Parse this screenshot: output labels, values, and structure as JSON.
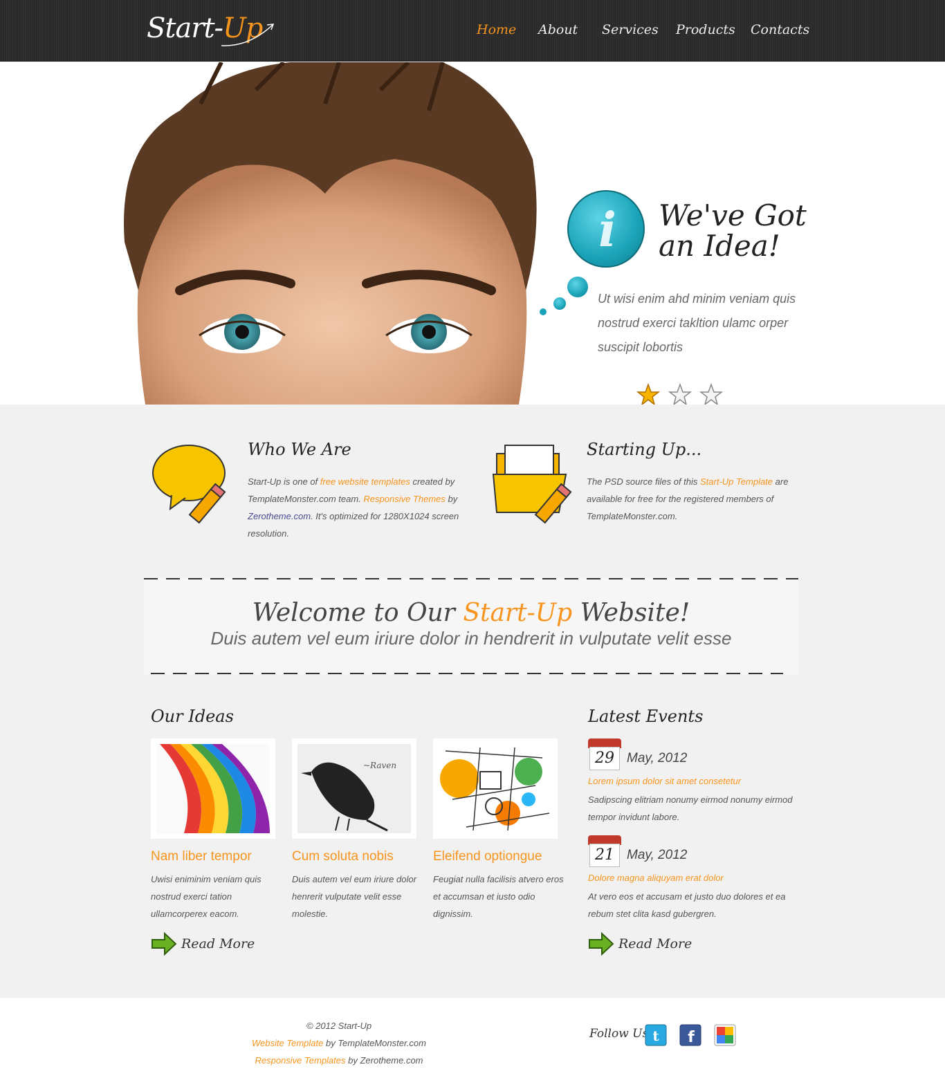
{
  "header": {
    "logo_main": "Start-",
    "logo_accent": "Up",
    "nav": [
      {
        "label": "Home",
        "active": true
      },
      {
        "label": "About",
        "active": false
      },
      {
        "label": "Services",
        "active": false
      },
      {
        "label": "Products",
        "active": false
      },
      {
        "label": "Contacts",
        "active": false
      }
    ]
  },
  "hero": {
    "icon": "info-bubble-icon",
    "title_line1": "We've Got",
    "title_line2": "an Idea!",
    "text": "Ut wisi enim ahd minim veniam quis nostrud exerci takltion ulamc orper suscipit lobortis",
    "rating": {
      "value": 1,
      "max": 3
    }
  },
  "features": [
    {
      "icon": "speech-bubble-pencil-icon",
      "title": "Who We Are",
      "t1": "Start-Up is one of ",
      "l1": "free website templates",
      "t2": " created by TemplateMonster.com team. ",
      "l2": "Responsive Themes",
      "t3": " by ",
      "l3": "Zerotheme.com",
      "t4": ". It's optimized for 1280X1024 screen resolution."
    },
    {
      "icon": "folder-pencil-icon",
      "title": "Starting Up...",
      "t1": "The PSD source files of this ",
      "l1": "Start-Up Template",
      "t2": " are available for free for the registered members of TemplateMonster.com."
    }
  ],
  "welcome": {
    "title_pre": "Welcome to Our ",
    "title_accent": "Start-Up",
    "title_post": " Website!",
    "subtitle": "Duis autem vel eum iriure dolor in hendrerit in vulputate velit esse"
  },
  "ideas": {
    "heading": "Our Ideas",
    "items": [
      {
        "title": "Nam liber tempor",
        "text": "Uwisi eniminim veniam quis nostrud exerci tation ullamcorperex eacom."
      },
      {
        "title": "Cum soluta nobis",
        "text": "Duis autem vel eum iriure dolor henrerit vulputate velit esse molestie."
      },
      {
        "title": "Eleifend optiongue",
        "text": "Feugiat nulla facilisis atvero eros et accumsan et iusto odio dignissim."
      }
    ],
    "read_more": "Read More"
  },
  "events": {
    "heading": "Latest Events",
    "items": [
      {
        "day": "29",
        "date": "May, 2012",
        "title": "Lorem ipsum dolor sit amet consetetur",
        "text": "Sadipscing elitriam nonumy eirmod nonumy eirmod tempor invidunt labore."
      },
      {
        "day": "21",
        "date": "May, 2012",
        "title": "Dolore magna aliquyam erat dolor",
        "text": "At vero eos et accusam et justo duo dolores et ea rebum stet clita kasd gubergren."
      }
    ],
    "read_more": "Read More"
  },
  "footer": {
    "copyright": "© 2012 Start-Up",
    "line2_link": "Website Template",
    "line2_rest": " by TemplateMonster.com",
    "line3_link": "Responsive Templates",
    "line3_rest": " by Zerotheme.com",
    "follow": "Follow Us:",
    "social": [
      "twitter-icon",
      "facebook-icon",
      "google-icon"
    ]
  },
  "colors": {
    "accent": "#f7941d",
    "header_bg": "#2a2a2a",
    "bubble": "#1aa3b8",
    "body_bg": "#f1f1f1"
  }
}
